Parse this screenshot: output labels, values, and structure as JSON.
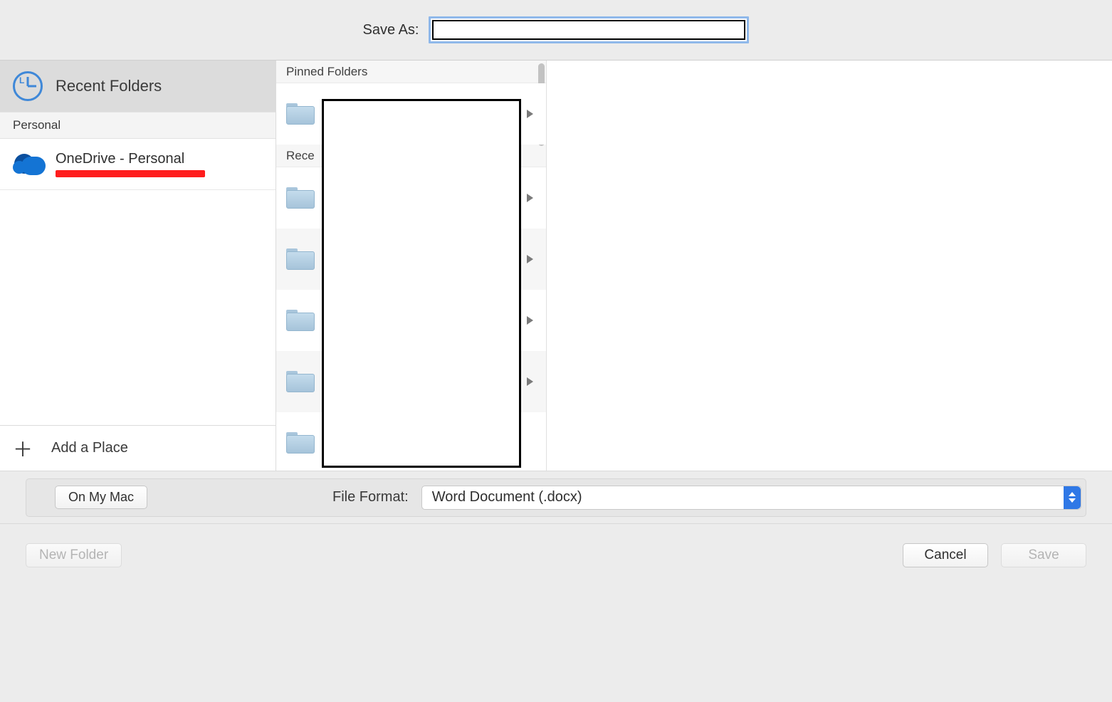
{
  "saveAs": {
    "label": "Save As:",
    "value": ""
  },
  "sidebar": {
    "recent_label": "Recent Folders",
    "personal_header": "Personal",
    "onedrive_label": "OneDrive - Personal",
    "add_place_label": "Add a Place"
  },
  "folderColumn": {
    "pinned_header": "Pinned Folders",
    "recent_header": "Rece",
    "pinned": [
      {
        "name": ""
      }
    ],
    "recent": [
      {
        "name": ""
      },
      {
        "name": ""
      },
      {
        "name": ""
      },
      {
        "name": ""
      },
      {
        "name": ""
      }
    ]
  },
  "formatBar": {
    "on_my_mac": "On My Mac",
    "file_format_label": "File Format:",
    "file_format_value": "Word Document (.docx)"
  },
  "bottom": {
    "new_folder": "New Folder",
    "cancel": "Cancel",
    "save": "Save"
  }
}
